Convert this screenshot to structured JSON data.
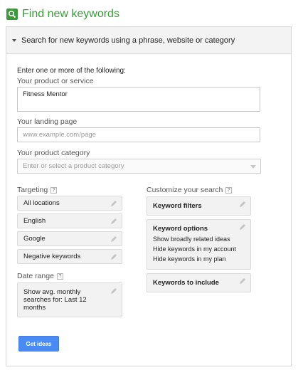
{
  "header": {
    "title": "Find new keywords",
    "icon": "search-icon",
    "accent_color": "#3c9a3c"
  },
  "panel": {
    "heading": "Search for new keywords using a phrase, website or category",
    "intro": "Enter one or more of the following:",
    "product": {
      "label": "Your product or service",
      "value": "Fitness Mentor"
    },
    "landing": {
      "label": "Your landing page",
      "placeholder": "www.example.com/page"
    },
    "category": {
      "label": "Your product category",
      "placeholder": "Enter or select a product category"
    }
  },
  "targeting": {
    "label": "Targeting",
    "items": [
      "All locations",
      "English",
      "Google",
      "Negative keywords"
    ]
  },
  "date_range": {
    "label": "Date range",
    "value": "Show avg. monthly searches for: Last 12 months"
  },
  "customize": {
    "label": "Customize your search",
    "filters_title": "Keyword filters",
    "options_title": "Keyword options",
    "options": [
      "Show broadly related ideas",
      "Hide keywords in my account",
      "Hide keywords in my plan"
    ],
    "include_title": "Keywords to include"
  },
  "actions": {
    "get_ideas": "Get ideas",
    "button_color": "#4a8af4"
  }
}
